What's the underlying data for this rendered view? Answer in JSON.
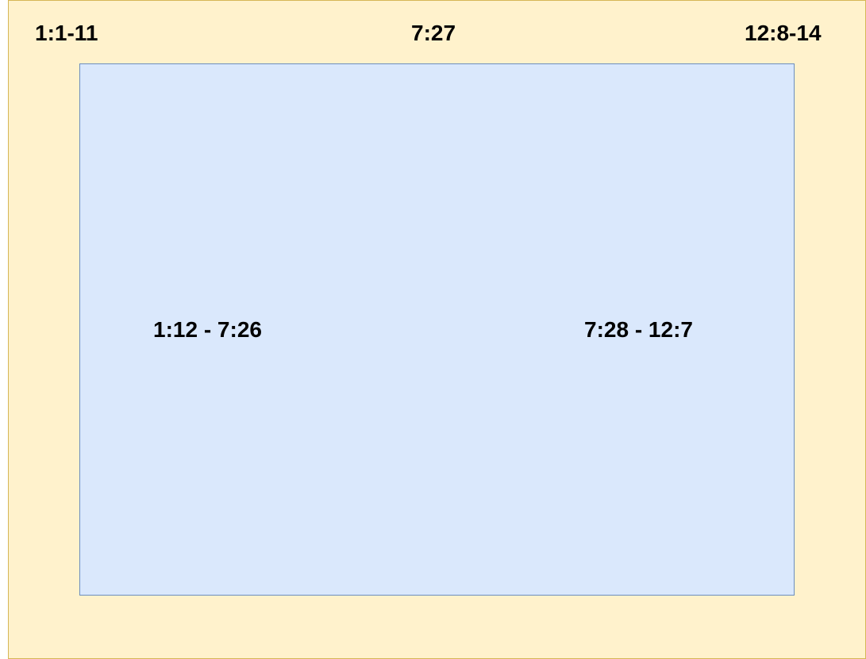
{
  "frame": {
    "colors": {
      "outer_fill": "#fff2cc",
      "outer_border": "#d6b656",
      "inner_fill": "#dae8fc",
      "inner_border": "#6c8ebf"
    }
  },
  "labels": {
    "top_left": "1:1-11",
    "top_center": "7:27",
    "top_right": "12:8-14",
    "middle_left": "1:12 - 7:26",
    "middle_right": "7:28 - 12:7"
  }
}
